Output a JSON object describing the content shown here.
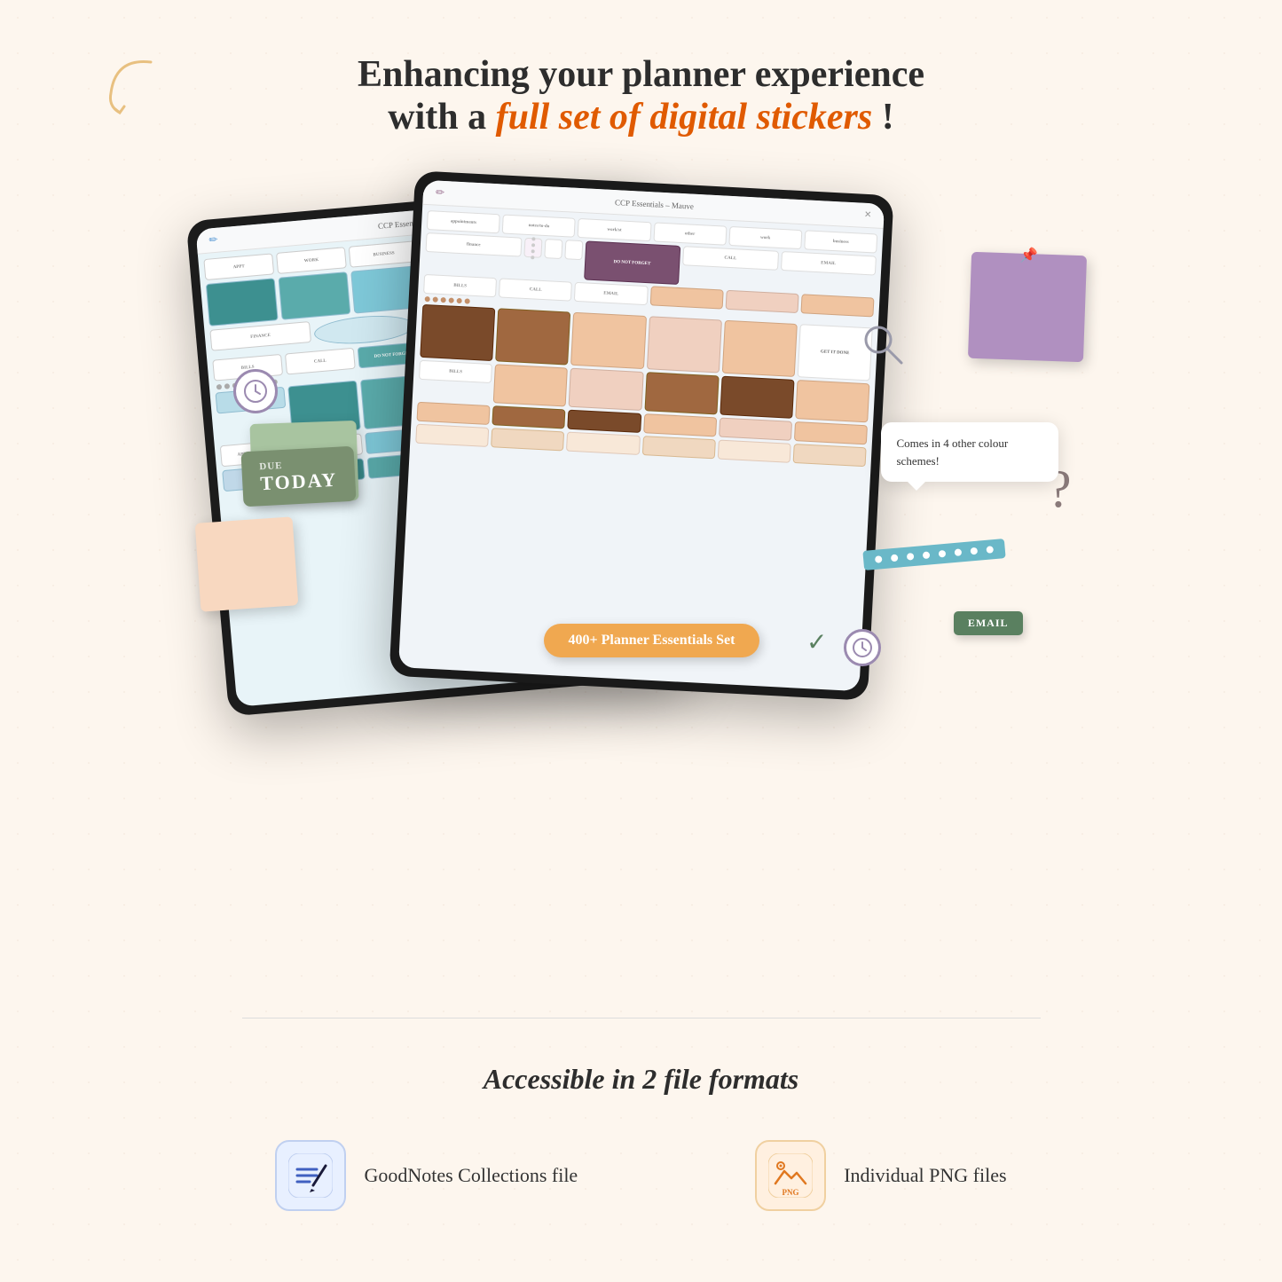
{
  "header": {
    "line1": "Enhancing your planner experience",
    "line2_prefix": "with a ",
    "line2_highlight": "full set of digital stickers",
    "line2_suffix": "!",
    "arrow_decoration": "curved arrow"
  },
  "tablets": {
    "back_tablet": {
      "title": "CCP Essentials – Powder",
      "theme": "teal/powder blue"
    },
    "front_tablet": {
      "title": "CCP Essentials – Mauve",
      "theme": "mauve/brown"
    }
  },
  "floating_elements": {
    "due_today": {
      "due_label": "DUE",
      "today_label": "TODAY"
    },
    "do_not_forget": "Do NoT\nFORGET",
    "email_label": "EMAIL",
    "tooltip": {
      "text": "Comes in 4 other colour schemes!"
    },
    "badge_400": "400+ Planner Essentials Set",
    "question_mark": "?"
  },
  "footer": {
    "title": "Accessible in 2 file formats",
    "formats": [
      {
        "icon_type": "goodnotes",
        "label": "GoodNotes Collections file"
      },
      {
        "icon_type": "png",
        "label": "Individual PNG files"
      }
    ]
  }
}
